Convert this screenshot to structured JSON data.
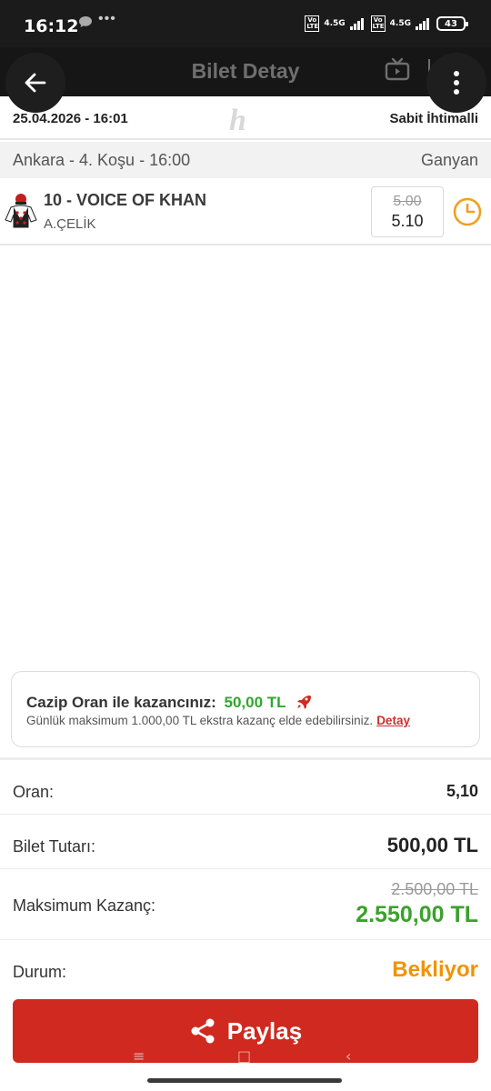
{
  "status_bar": {
    "time": "16:12",
    "dots": "•••",
    "network_1": "4.5G",
    "network_2": "4.5G",
    "volte_1": "Vo LTE",
    "volte_2": "Vo LTE",
    "battery": "43"
  },
  "header": {
    "title": "Bilet Detay",
    "back_ghost": "‹"
  },
  "ticket": {
    "date": "25.04.2026 - 16:01",
    "type": "Sabit İhtimalli",
    "race": "Ankara - 4. Koşu - 16:00",
    "bet_type": "Ganyan",
    "horse": "10 - VOICE OF KHAN",
    "jockey": "A.ÇELİK",
    "odds_old": "5.00",
    "odds_new": "5.10"
  },
  "promo": {
    "label": "Cazip Oran ile kazancınız:",
    "amount": "50,00 TL",
    "subtitle": "Günlük maksimum 1.000,00 TL ekstra kazanç elde edebilirsiniz.",
    "link": "Detay"
  },
  "summary": {
    "oran_label": "Oran:",
    "oran_value": "5,10",
    "tutar_label": "Bilet Tutarı:",
    "tutar_value": "500,00 TL",
    "kazanc_label": "Maksimum Kazanç:",
    "kazanc_old": "2.500,00 TL",
    "kazanc_new": "2.550,00 TL",
    "durum_label": "Durum:",
    "durum_value": "Bekliyor"
  },
  "share": {
    "label": "Paylaş"
  },
  "colors": {
    "accent_red": "#d02a20",
    "win_green": "#3aa12b",
    "pending_orange": "#f39200",
    "clock_orange": "#f0a020"
  },
  "icons": [
    "back-arrow-icon",
    "more-vertical-icon",
    "tv-icon",
    "jockey-silk-icon",
    "clock-icon",
    "rocket-icon",
    "share-icon"
  ]
}
